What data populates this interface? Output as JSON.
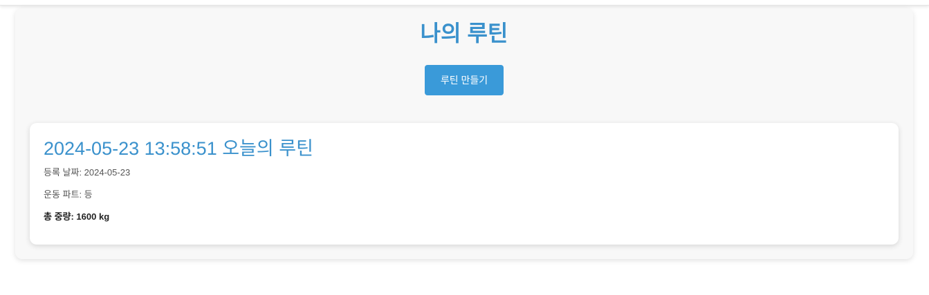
{
  "page": {
    "title": "나의 루틴",
    "create_button_label": "루틴 만들기"
  },
  "routines": [
    {
      "title": "2024-05-23 13:58:51 오늘의 루틴",
      "date_text": "등록 날짜: 2024-05-23",
      "part_text": "운동 파트: 등",
      "weight_text": "총 중량: 1600 kg"
    }
  ],
  "colors": {
    "accent_text": "#3a91cc",
    "button_bg": "#3a9ad9",
    "panel_bg": "#f8f8f8",
    "card_bg": "#ffffff"
  }
}
